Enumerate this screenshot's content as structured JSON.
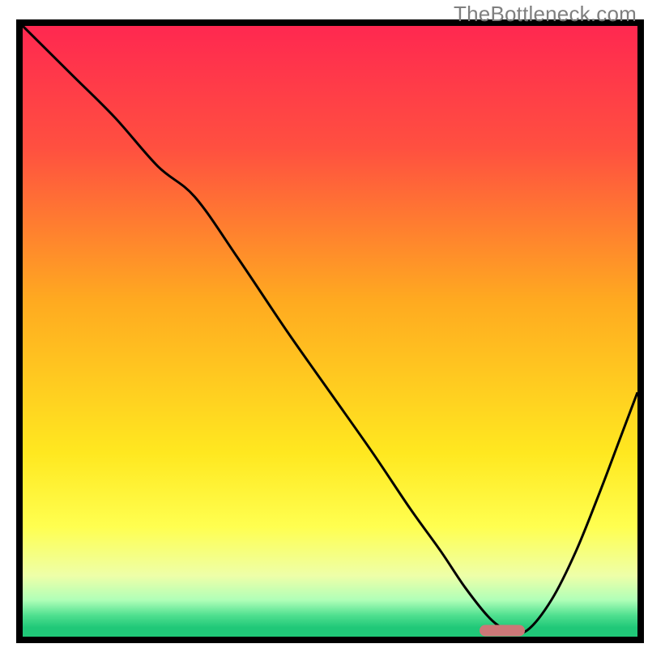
{
  "watermarkText": "TheBottleneck.com",
  "chart_data": {
    "type": "line",
    "title": "",
    "xlabel": "",
    "ylabel": "",
    "xlim": [
      0,
      100
    ],
    "ylim": [
      0,
      100
    ],
    "legend": false,
    "grid": false,
    "background": "rainbow-vert",
    "series": [
      {
        "name": "curve",
        "x": [
          0,
          8,
          15,
          22,
          28,
          35,
          43,
          50,
          57,
          63,
          68,
          72,
          76,
          79,
          82,
          86,
          90,
          94,
          97,
          100
        ],
        "y": [
          100,
          92,
          85,
          77,
          72,
          62,
          50,
          40,
          30,
          21,
          14,
          8,
          3,
          1,
          1,
          6,
          14,
          24,
          32,
          40
        ]
      }
    ],
    "marker": {
      "name": "highlight",
      "x": 78,
      "y": 1,
      "color": "#cc7777",
      "shape": "pill"
    },
    "gradient_stops": [
      {
        "offset": 0.0,
        "color": "#ff2850"
      },
      {
        "offset": 0.2,
        "color": "#ff5040"
      },
      {
        "offset": 0.45,
        "color": "#ffaa20"
      },
      {
        "offset": 0.7,
        "color": "#ffe820"
      },
      {
        "offset": 0.82,
        "color": "#ffff50"
      },
      {
        "offset": 0.9,
        "color": "#eeffa8"
      },
      {
        "offset": 0.94,
        "color": "#b0ffb8"
      },
      {
        "offset": 0.965,
        "color": "#50e090"
      },
      {
        "offset": 0.985,
        "color": "#20c878"
      },
      {
        "offset": 1.0,
        "color": "#20c878"
      }
    ],
    "frame": {
      "color": "#000000",
      "width": 8
    }
  }
}
